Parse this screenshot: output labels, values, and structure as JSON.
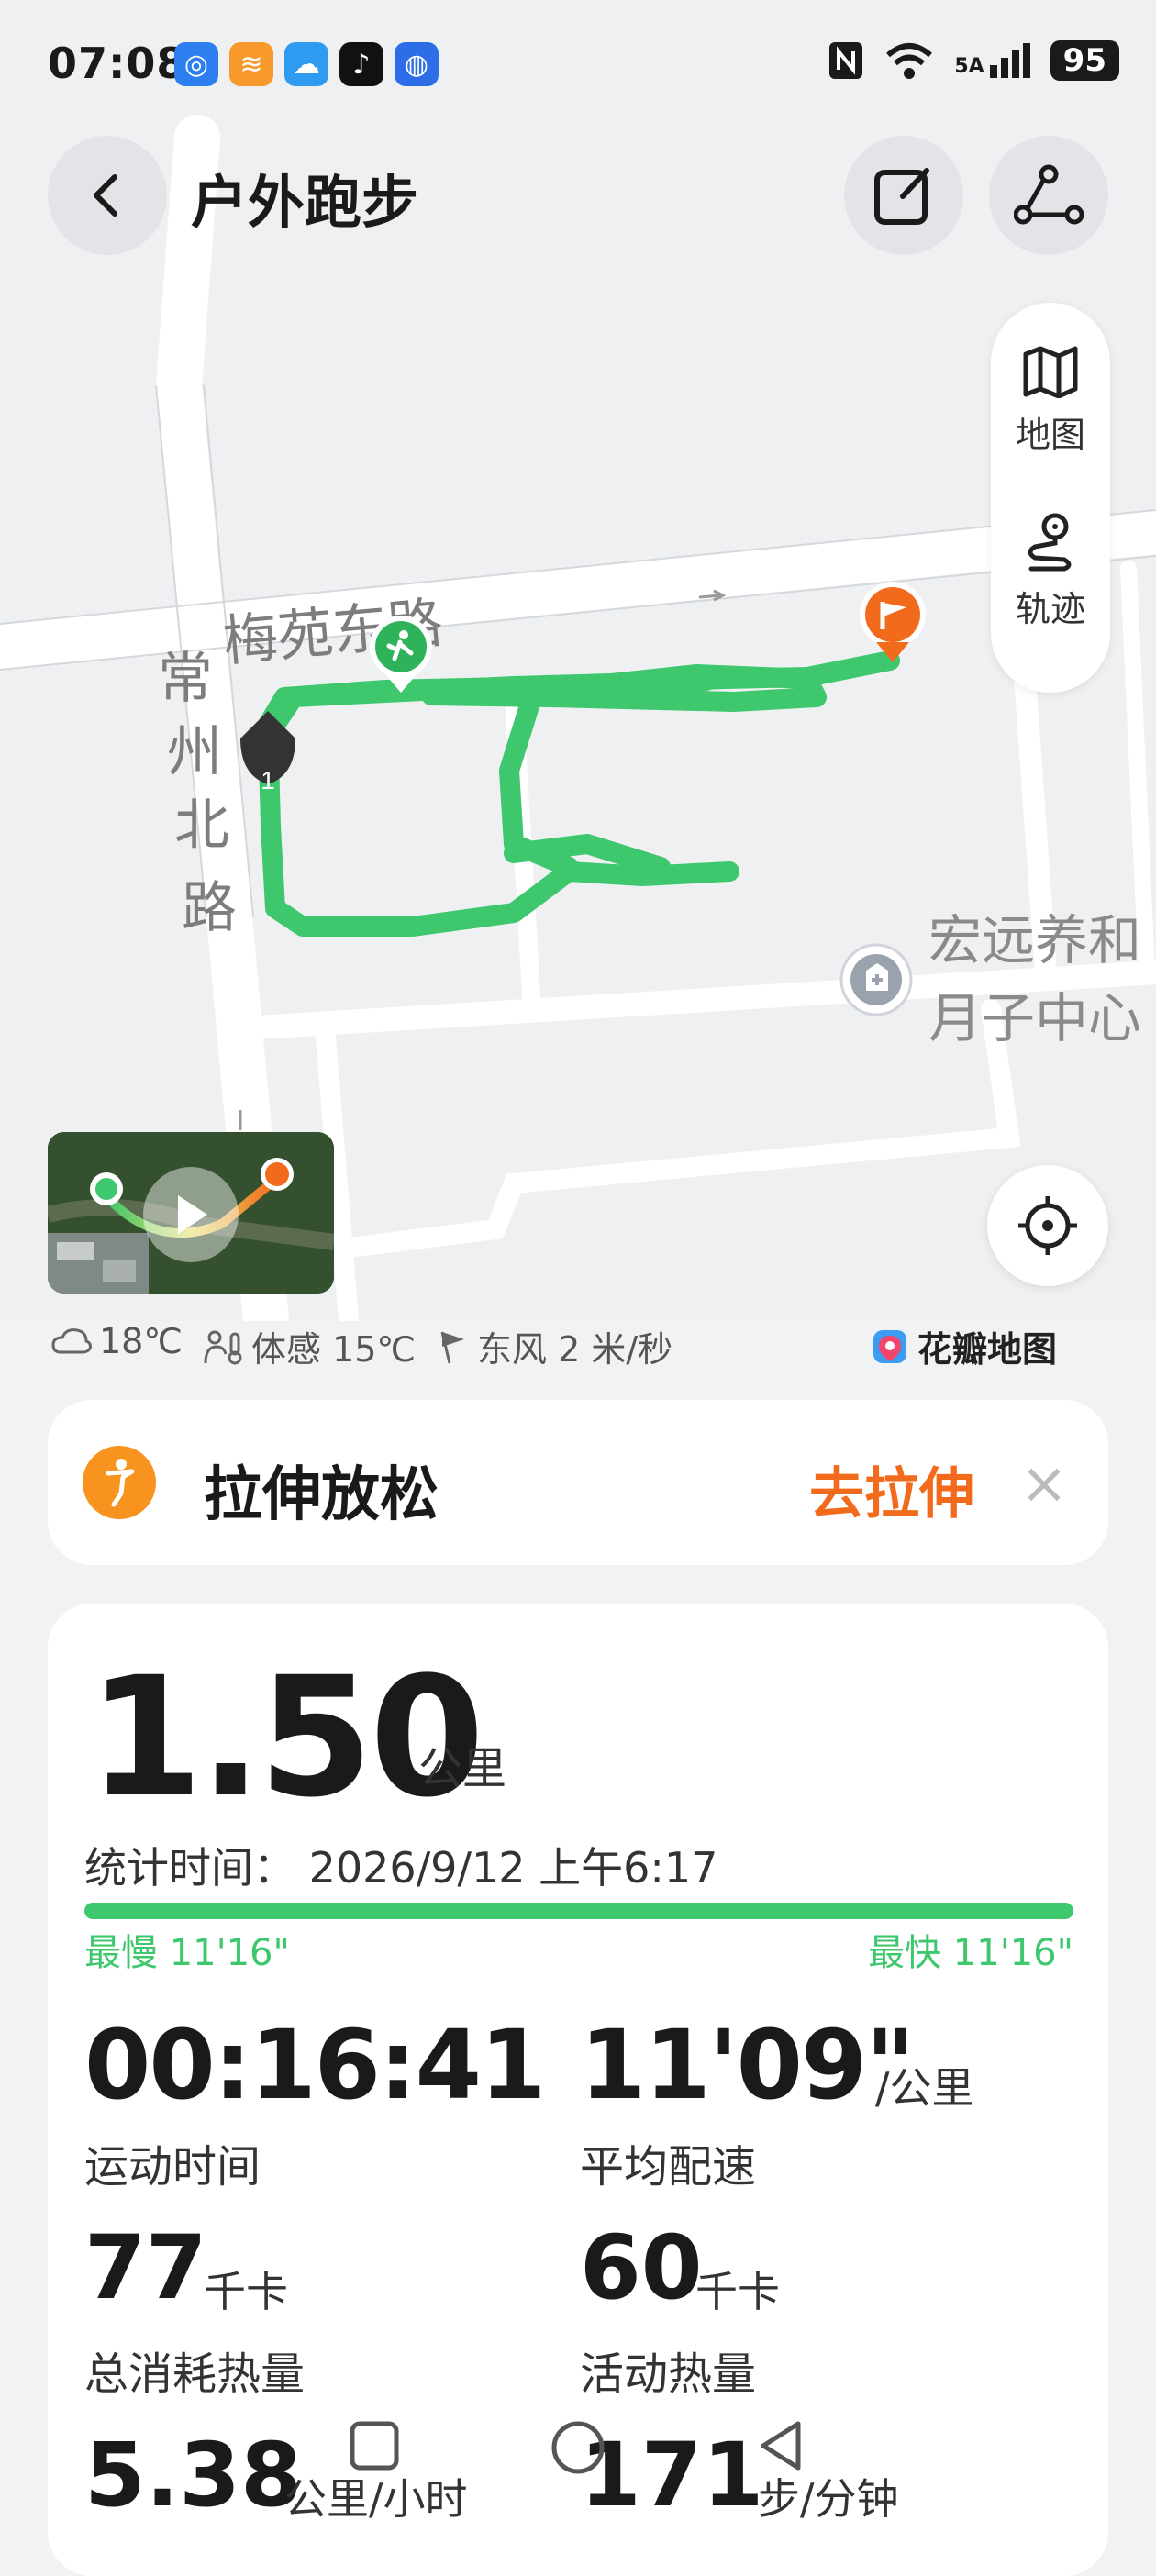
{
  "status_bar": {
    "time": "07:08",
    "network": "5A",
    "battery": "95",
    "apps": [
      "browser-icon",
      "app-orange-icon",
      "weather-icon",
      "tiktok-icon",
      "bulb-icon"
    ]
  },
  "header": {
    "title": "户外跑步",
    "back_icon": "chevron-left-icon",
    "edit_icon": "edit-icon",
    "share_icon": "route-share-icon"
  },
  "map": {
    "road_labels": {
      "meiyuan": "梅苑东路",
      "changzhou": [
        "常",
        "州",
        "北",
        "路"
      ]
    },
    "poi": [
      "宏远养和",
      "月子中心"
    ],
    "lap_marker": "1",
    "switch": {
      "map_label": "地图",
      "track_label": "轨迹"
    },
    "route_color": "#3ec76d",
    "start_color": "#2fb35a",
    "end_color": "#f26b1d"
  },
  "weather": {
    "temperature": "18℃",
    "feels_like": "体感 15℃",
    "wind": "东风  2 米/秒"
  },
  "brand": "花瓣地图",
  "stretch_card": {
    "title": "拉伸放松",
    "action": "去拉伸",
    "close": "×"
  },
  "summary": {
    "distance": "1.50",
    "distance_unit": "公里",
    "stat_time": "统计时间：  2026/9/12 上午6:17",
    "slowest": "最慢 11'16\"",
    "fastest": "最快 11'16\"",
    "duration": "00:16:41",
    "duration_label": "运动时间",
    "avg_pace": "11'09\"",
    "avg_pace_unit": "/公里",
    "avg_pace_label": "平均配速",
    "total_cal": "77",
    "total_cal_unit": "千卡",
    "total_cal_label": "总消耗热量",
    "active_cal": "60",
    "active_cal_unit": "千卡",
    "active_cal_label": "活动热量",
    "speed": "5.38",
    "speed_unit": "公里/小时",
    "cadence": "171",
    "cadence_unit": "步/分钟"
  },
  "accent_colors": {
    "green": "#3ec76d",
    "orange": "#f26b1d"
  }
}
